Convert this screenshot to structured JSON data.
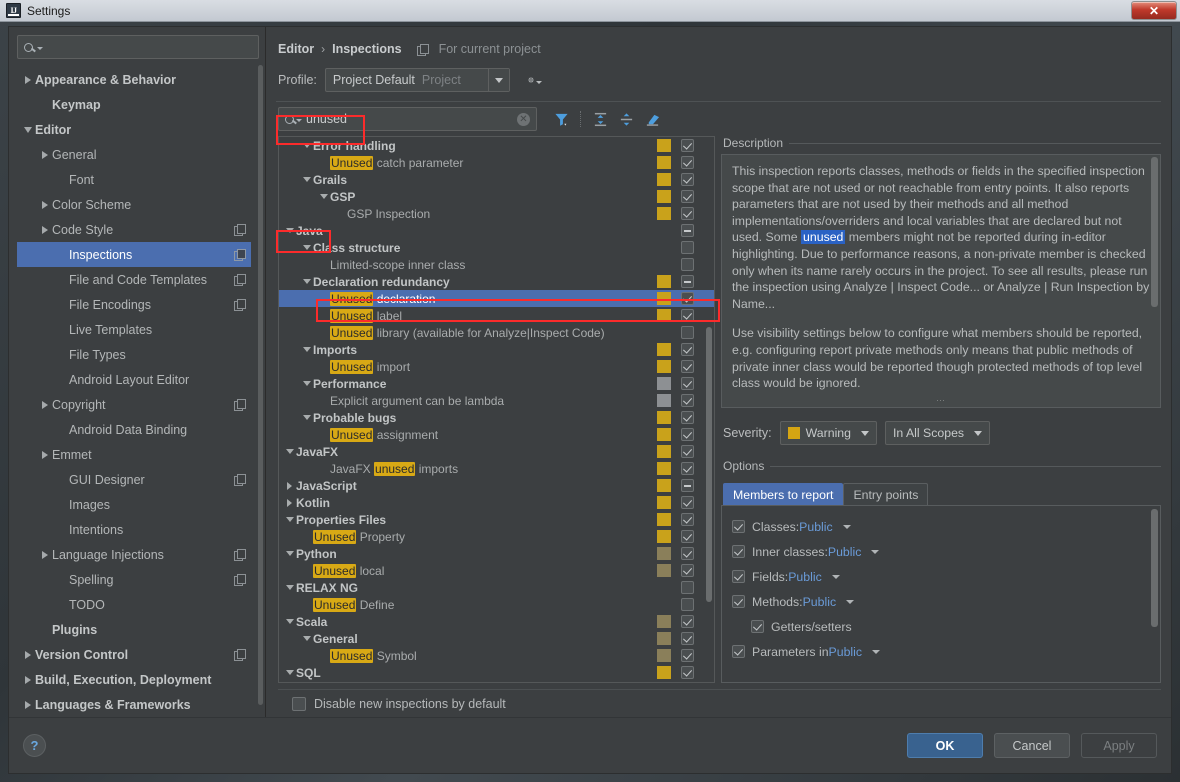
{
  "window": {
    "title": "Settings",
    "close_label": "✕",
    "logo_text": "IJ"
  },
  "sidebar": {
    "search_placeholder": "",
    "search_value": "",
    "items": [
      {
        "label": "Appearance & Behavior",
        "arrow": "closed",
        "bold": true,
        "indent": 0,
        "badge": false,
        "selected": false
      },
      {
        "label": "Keymap",
        "arrow": "none",
        "bold": true,
        "indent": 1,
        "badge": false,
        "selected": false
      },
      {
        "label": "Editor",
        "arrow": "open",
        "bold": true,
        "indent": 0,
        "badge": false,
        "selected": false
      },
      {
        "label": "General",
        "arrow": "closed",
        "bold": false,
        "indent": 1,
        "badge": false,
        "selected": false
      },
      {
        "label": "Font",
        "arrow": "none",
        "bold": false,
        "indent": 2,
        "badge": false,
        "selected": false
      },
      {
        "label": "Color Scheme",
        "arrow": "closed",
        "bold": false,
        "indent": 1,
        "badge": false,
        "selected": false
      },
      {
        "label": "Code Style",
        "arrow": "closed",
        "bold": false,
        "indent": 1,
        "badge": true,
        "selected": false
      },
      {
        "label": "Inspections",
        "arrow": "none",
        "bold": false,
        "indent": 2,
        "badge": true,
        "selected": true
      },
      {
        "label": "File and Code Templates",
        "arrow": "none",
        "bold": false,
        "indent": 2,
        "badge": true,
        "selected": false
      },
      {
        "label": "File Encodings",
        "arrow": "none",
        "bold": false,
        "indent": 2,
        "badge": true,
        "selected": false
      },
      {
        "label": "Live Templates",
        "arrow": "none",
        "bold": false,
        "indent": 2,
        "badge": false,
        "selected": false
      },
      {
        "label": "File Types",
        "arrow": "none",
        "bold": false,
        "indent": 2,
        "badge": false,
        "selected": false
      },
      {
        "label": "Android Layout Editor",
        "arrow": "none",
        "bold": false,
        "indent": 2,
        "badge": false,
        "selected": false
      },
      {
        "label": "Copyright",
        "arrow": "closed",
        "bold": false,
        "indent": 1,
        "badge": true,
        "selected": false
      },
      {
        "label": "Android Data Binding",
        "arrow": "none",
        "bold": false,
        "indent": 2,
        "badge": false,
        "selected": false
      },
      {
        "label": "Emmet",
        "arrow": "closed",
        "bold": false,
        "indent": 1,
        "badge": false,
        "selected": false
      },
      {
        "label": "GUI Designer",
        "arrow": "none",
        "bold": false,
        "indent": 2,
        "badge": true,
        "selected": false
      },
      {
        "label": "Images",
        "arrow": "none",
        "bold": false,
        "indent": 2,
        "badge": false,
        "selected": false
      },
      {
        "label": "Intentions",
        "arrow": "none",
        "bold": false,
        "indent": 2,
        "badge": false,
        "selected": false
      },
      {
        "label": "Language Injections",
        "arrow": "closed",
        "bold": false,
        "indent": 1,
        "badge": true,
        "selected": false
      },
      {
        "label": "Spelling",
        "arrow": "none",
        "bold": false,
        "indent": 2,
        "badge": true,
        "selected": false
      },
      {
        "label": "TODO",
        "arrow": "none",
        "bold": false,
        "indent": 2,
        "badge": false,
        "selected": false
      },
      {
        "label": "Plugins",
        "arrow": "none",
        "bold": true,
        "indent": 1,
        "badge": false,
        "selected": false
      },
      {
        "label": "Version Control",
        "arrow": "closed",
        "bold": true,
        "indent": 0,
        "badge": true,
        "selected": false
      },
      {
        "label": "Build, Execution, Deployment",
        "arrow": "closed",
        "bold": true,
        "indent": 0,
        "badge": false,
        "selected": false
      },
      {
        "label": "Languages & Frameworks",
        "arrow": "closed",
        "bold": true,
        "indent": 0,
        "badge": false,
        "selected": false
      }
    ]
  },
  "breadcrumb": {
    "root": "Editor",
    "separator": "›",
    "current": "Inspections",
    "scope_note": "For current project"
  },
  "profile": {
    "label": "Profile:",
    "name": "Project Default",
    "scope": "Project"
  },
  "find": {
    "value": "unused",
    "icons": [
      "filter-icon",
      "expand-all-icon",
      "collapse-all-icon",
      "reset-icon"
    ]
  },
  "inspections": [
    {
      "label": "Error handling",
      "arrow": "open",
      "group": true,
      "indent": 1,
      "sev": "gold",
      "check": "checked",
      "selected": false
    },
    {
      "label": "catch parameter",
      "hl": "Unused",
      "arrow": "none",
      "group": false,
      "indent": 2,
      "sev": "gold",
      "check": "checked",
      "selected": false
    },
    {
      "label": "Grails",
      "arrow": "open",
      "group": true,
      "indent": 1,
      "sev": "gold",
      "check": "checked",
      "selected": false
    },
    {
      "label": "GSP",
      "arrow": "open",
      "group": true,
      "indent": 2,
      "sev": "gold",
      "check": "checked",
      "selected": false
    },
    {
      "label": "GSP Inspection",
      "arrow": "none",
      "group": false,
      "indent": 3,
      "sev": "gold",
      "check": "checked",
      "selected": false
    },
    {
      "label": "Java",
      "arrow": "open",
      "group": true,
      "indent": 0,
      "sev": "none",
      "check": "dash",
      "selected": false
    },
    {
      "label": "Class structure",
      "arrow": "open",
      "group": true,
      "indent": 1,
      "sev": "none",
      "check": "empty",
      "selected": false
    },
    {
      "label": "Limited-scope inner class",
      "arrow": "none",
      "group": false,
      "indent": 2,
      "sev": "none",
      "check": "empty",
      "selected": false
    },
    {
      "label": "Declaration redundancy",
      "arrow": "open",
      "group": true,
      "indent": 1,
      "sev": "gold",
      "check": "dash",
      "selected": false
    },
    {
      "label": "declaration",
      "hl": "Unused",
      "arrow": "none",
      "group": false,
      "indent": 2,
      "sev": "gold",
      "check": "checked",
      "selected": true
    },
    {
      "label": "label",
      "hl": "Unused",
      "arrow": "none",
      "group": false,
      "indent": 2,
      "sev": "gold",
      "check": "checked",
      "selected": false
    },
    {
      "label": "library (available for Analyze|Inspect Code)",
      "hl": "Unused",
      "arrow": "none",
      "group": false,
      "indent": 2,
      "sev": "none",
      "check": "empty",
      "selected": false
    },
    {
      "label": "Imports",
      "arrow": "open",
      "group": true,
      "indent": 1,
      "sev": "gold",
      "check": "checked",
      "selected": false
    },
    {
      "label": "import",
      "hl": "Unused",
      "arrow": "none",
      "group": false,
      "indent": 2,
      "sev": "gold",
      "check": "checked",
      "selected": false
    },
    {
      "label": "Performance",
      "arrow": "open",
      "group": true,
      "indent": 1,
      "sev": "gray",
      "check": "checked",
      "selected": false
    },
    {
      "label": "Explicit argument can be lambda",
      "arrow": "none",
      "group": false,
      "indent": 2,
      "sev": "gray",
      "check": "checked",
      "selected": false
    },
    {
      "label": "Probable bugs",
      "arrow": "open",
      "group": true,
      "indent": 1,
      "sev": "gold",
      "check": "checked",
      "selected": false
    },
    {
      "label": "assignment",
      "hl": "Unused",
      "arrow": "none",
      "group": false,
      "indent": 2,
      "sev": "gold",
      "check": "checked",
      "selected": false
    },
    {
      "label": "JavaFX",
      "arrow": "open",
      "group": true,
      "indent": 0,
      "sev": "gold",
      "check": "checked",
      "selected": false
    },
    {
      "label": "JavaFX |unused| imports",
      "hlmid": "unused",
      "pre": "JavaFX ",
      "post": " imports",
      "arrow": "none",
      "group": false,
      "indent": 2,
      "sev": "gold",
      "check": "checked",
      "selected": false
    },
    {
      "label": "JavaScript",
      "arrow": "closed",
      "group": true,
      "indent": 0,
      "sev": "gold",
      "check": "dash",
      "selected": false
    },
    {
      "label": "Kotlin",
      "arrow": "closed",
      "group": true,
      "indent": 0,
      "sev": "gold",
      "check": "checked",
      "selected": false
    },
    {
      "label": "Properties Files",
      "arrow": "open",
      "group": true,
      "indent": 0,
      "sev": "gold",
      "check": "checked",
      "selected": false
    },
    {
      "label": "Property",
      "hl": "Unused",
      "arrow": "none",
      "group": false,
      "indent": 1,
      "sev": "gold",
      "check": "checked",
      "selected": false
    },
    {
      "label": "Python",
      "arrow": "open",
      "group": true,
      "indent": 0,
      "sev": "olive",
      "check": "checked",
      "selected": false
    },
    {
      "label": "local",
      "hl": "Unused",
      "arrow": "none",
      "group": false,
      "indent": 1,
      "sev": "olive",
      "check": "checked",
      "selected": false
    },
    {
      "label": "RELAX NG",
      "arrow": "open",
      "group": true,
      "indent": 0,
      "sev": "none",
      "check": "empty",
      "selected": false
    },
    {
      "label": "Define",
      "hl": "Unused",
      "arrow": "none",
      "group": false,
      "indent": 1,
      "sev": "none",
      "check": "empty",
      "selected": false
    },
    {
      "label": "Scala",
      "arrow": "open",
      "group": true,
      "indent": 0,
      "sev": "olive",
      "check": "checked",
      "selected": false
    },
    {
      "label": "General",
      "arrow": "open",
      "group": true,
      "indent": 1,
      "sev": "olive",
      "check": "checked",
      "selected": false
    },
    {
      "label": "Symbol",
      "hl": "Unused",
      "arrow": "none",
      "group": false,
      "indent": 2,
      "sev": "olive",
      "check": "checked",
      "selected": false
    },
    {
      "label": "SQL",
      "arrow": "open",
      "group": true,
      "indent": 0,
      "sev": "gold",
      "check": "checked",
      "selected": false
    }
  ],
  "description": {
    "title": "Description",
    "para1_a": "This inspection reports classes, methods or fields in the specified inspection scope that are not used or not reachable from entry points. It also reports parameters that are not used by their methods and all method implementations/overriders and local variables that are declared but not used. Some ",
    "highlight": "unused",
    "para1_b": " members might not be reported during in-editor highlighting. Due to performance reasons, a non-private member is checked only when its name rarely occurs in the project. To see all results, please run the inspection using Analyze | Inspect Code... or Analyze | Run Inspection by Name...",
    "para2": "Use visibility settings below to configure what members should be reported, e.g. configuring report private methods only means that public methods of private inner class would be reported though protected methods of top level class would be ignored."
  },
  "severity": {
    "label": "Severity:",
    "value": "Warning",
    "color": "#d5a513",
    "scope": "In All Scopes"
  },
  "options": {
    "title": "Options",
    "tabs": [
      {
        "label": "Members to report",
        "active": true
      },
      {
        "label": "Entry points",
        "active": false
      }
    ],
    "rows": [
      {
        "checked": true,
        "prefix": "Classes:",
        "value": "Public",
        "caret": true,
        "indent": false
      },
      {
        "checked": true,
        "prefix": "Inner classes:",
        "value": "Public",
        "caret": true,
        "indent": false
      },
      {
        "checked": true,
        "prefix": "Fields:",
        "value": "Public",
        "caret": true,
        "indent": false
      },
      {
        "checked": true,
        "prefix": "Methods:",
        "value": "Public",
        "caret": true,
        "indent": false
      },
      {
        "checked": true,
        "prefix": "Getters/setters",
        "value": "",
        "caret": false,
        "indent": true
      },
      {
        "checked": true,
        "prefix": "Parameters in",
        "value": "Public",
        "caret": true,
        "indent": false
      }
    ]
  },
  "footer": {
    "disable_label": "Disable new inspections by default",
    "disable_checked": false,
    "help": "?",
    "ok": "OK",
    "cancel": "Cancel",
    "apply": "Apply"
  }
}
